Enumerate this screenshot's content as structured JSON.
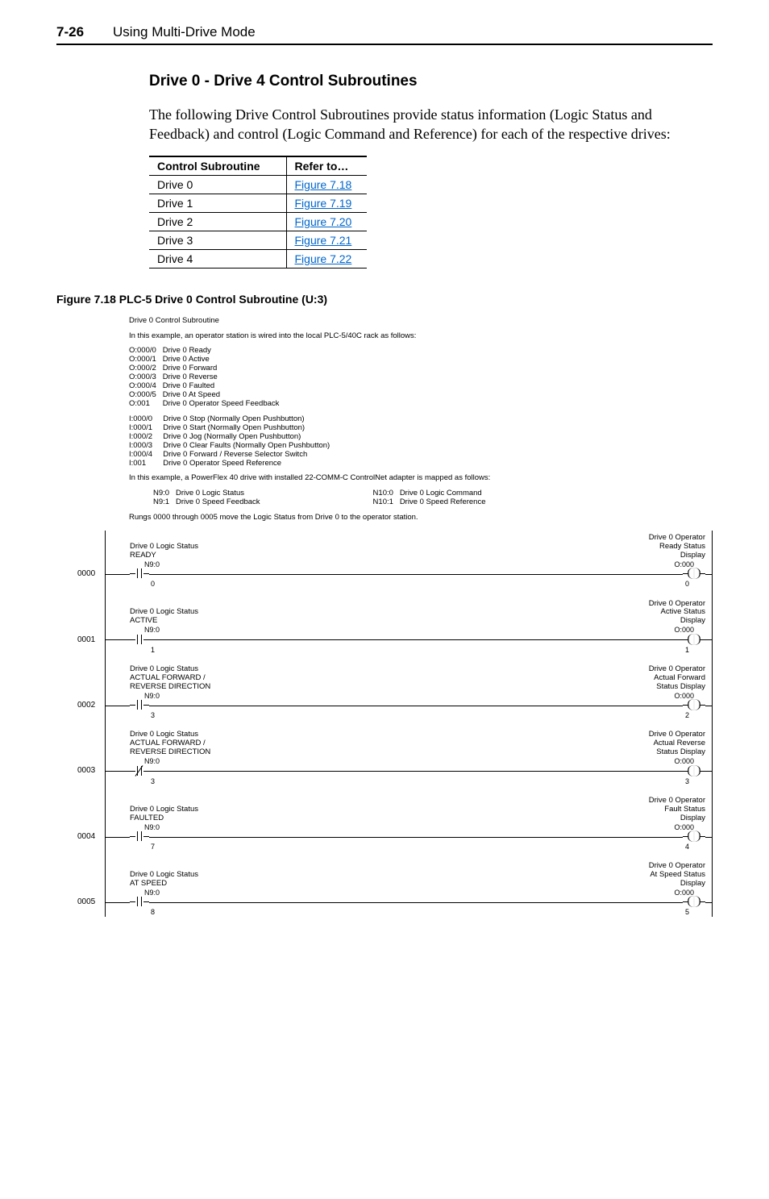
{
  "header": {
    "page_num": "7-26",
    "title": "Using Multi-Drive Mode"
  },
  "section": {
    "heading": "Drive 0 - Drive 4 Control Subroutines",
    "paragraph": "The following Drive Control Subroutines provide status information (Logic Status and Feedback) and control (Logic Command and Reference) for each of the respective drives:"
  },
  "table": {
    "h1": "Control Subroutine",
    "h2": "Refer to…",
    "rows": [
      {
        "c1": "Drive 0",
        "c2": "Figure 7.18"
      },
      {
        "c1": "Drive 1",
        "c2": "Figure 7.19"
      },
      {
        "c1": "Drive 2",
        "c2": "Figure 7.20"
      },
      {
        "c1": "Drive 3",
        "c2": "Figure 7.21"
      },
      {
        "c1": "Drive 4",
        "c2": "Figure 7.22"
      }
    ]
  },
  "figure": {
    "caption": "Figure 7.18   PLC-5 Drive 0 Control Subroutine (U:3)"
  },
  "ladder": {
    "title": "Drive 0 Control Subroutine",
    "intro": "In this example, an operator station is wired into the local PLC-5/40C rack as follows:",
    "outputs": "O:000/0   Drive 0 Ready\nO:000/1   Drive 0 Active\nO:000/2   Drive 0 Forward\nO:000/3   Drive 0 Reverse\nO:000/4   Drive 0 Faulted\nO:000/5   Drive 0 At Speed\nO:001      Drive 0 Operator Speed Feedback",
    "inputs": "I:000/0     Drive 0 Stop (Normally Open Pushbutton)\nI:000/1     Drive 0 Start (Normally Open Pushbutton)\nI:000/2     Drive 0 Jog (Normally Open Pushbutton)\nI:000/3     Drive 0 Clear Faults (Normally Open Pushbutton)\nI:000/4     Drive 0 Forward / Reverse Selector Switch\nI:001        Drive 0 Operator Speed Reference",
    "note": "In this example, a PowerFlex 40 drive with installed 22-COMM-C ControlNet adapter is mapped as follows:",
    "map_left": "N9:0   Drive 0 Logic Status\nN9:1   Drive 0 Speed Feedback",
    "map_right": "N10:0   Drive 0 Logic Command\nN10:1   Drive 0 Speed Reference",
    "rung_intro": "Rungs 0000 through 0005 move the Logic Status from Drive 0 to the operator station.",
    "rungs": [
      {
        "num": "0000",
        "in_label": "Drive 0 Logic Status\nREADY",
        "in_addr": "N9:0",
        "in_bit": "0",
        "in_type": "xic",
        "out_label": "Drive 0 Operator\nReady Status\nDisplay",
        "out_addr": "O:000",
        "out_bit": "0"
      },
      {
        "num": "0001",
        "in_label": "Drive 0 Logic Status\nACTIVE",
        "in_addr": "N9:0",
        "in_bit": "1",
        "in_type": "xic",
        "out_label": "Drive 0 Operator\nActive Status\nDisplay",
        "out_addr": "O:000",
        "out_bit": "1"
      },
      {
        "num": "0002",
        "in_label": "Drive 0 Logic Status\nACTUAL FORWARD /\nREVERSE DIRECTION",
        "in_addr": "N9:0",
        "in_bit": "3",
        "in_type": "xic",
        "out_label": "Drive 0 Operator\nActual Forward\nStatus Display",
        "out_addr": "O:000",
        "out_bit": "2"
      },
      {
        "num": "0003",
        "in_label": "Drive 0 Logic Status\nACTUAL FORWARD /\nREVERSE DIRECTION",
        "in_addr": "N9:0",
        "in_bit": "3",
        "in_type": "xio",
        "out_label": "Drive 0 Operator\nActual Reverse\nStatus Display",
        "out_addr": "O:000",
        "out_bit": "3"
      },
      {
        "num": "0004",
        "in_label": "Drive 0 Logic Status\nFAULTED",
        "in_addr": "N9:0",
        "in_bit": "7",
        "in_type": "xic",
        "out_label": "Drive 0 Operator\nFault Status\nDisplay",
        "out_addr": "O:000",
        "out_bit": "4"
      },
      {
        "num": "0005",
        "in_label": "Drive 0 Logic Status\nAT SPEED",
        "in_addr": "N9:0",
        "in_bit": "8",
        "in_type": "xic",
        "out_label": "Drive 0 Operator\nAt Speed Status\nDisplay",
        "out_addr": "O:000",
        "out_bit": "5"
      }
    ]
  }
}
